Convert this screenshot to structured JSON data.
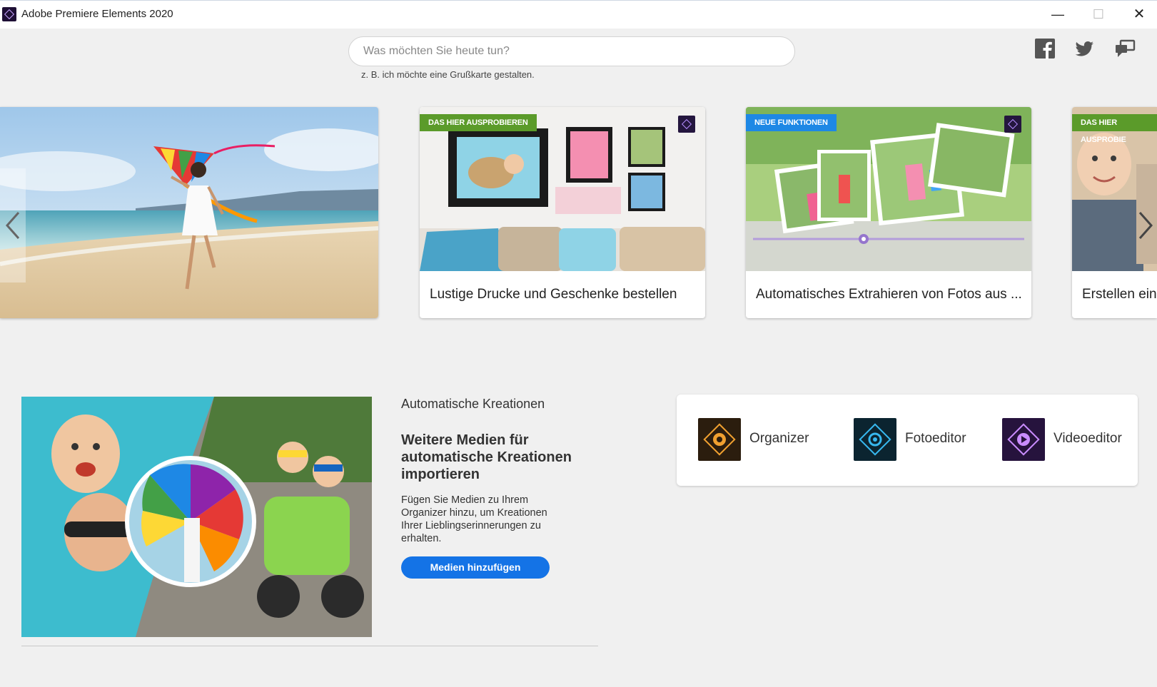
{
  "window": {
    "title": "Adobe Premiere Elements 2020",
    "controls": [
      "minimize",
      "maximize",
      "close"
    ]
  },
  "search": {
    "placeholder": "Was möchten Sie heute tun?",
    "hint": "z. B. ich möchte eine Grußkarte gestalten."
  },
  "social": {
    "icons": [
      "facebook-icon",
      "twitter-icon",
      "feedback-icon"
    ]
  },
  "carousel": {
    "cards": [
      {
        "badge": "DAS HIER AUSPROBIEREN",
        "label": "Lustige Drucke und Geschenke bestellen"
      },
      {
        "badge": "NEUE FUNKTIONEN",
        "label": "Automatisches Extrahieren von Fotos aus ..."
      },
      {
        "badge": "DAS HIER AUSPROBIE",
        "label": "Erstellen eine"
      }
    ]
  },
  "auto_creations": {
    "heading": "Automatische Kreationen",
    "title": "Weitere Medien für automatische Kreationen importieren",
    "description": "Fügen Sie Medien zu Ihrem Organizer hinzu, um Kreationen Ihrer Lieblingserinnerungen zu erhalten.",
    "button": "Medien hinzufügen"
  },
  "launcher": {
    "items": [
      {
        "label": "Organizer",
        "icon": "organizer-icon"
      },
      {
        "label": "Fotoeditor",
        "icon": "fotoeditor-icon"
      },
      {
        "label": "Videoeditor",
        "icon": "videoeditor-icon"
      }
    ]
  },
  "colors": {
    "accent": "#1473e6",
    "badge_green": "#5b9b2a",
    "badge_blue": "#1e88e5",
    "background": "#f0f0f0"
  }
}
